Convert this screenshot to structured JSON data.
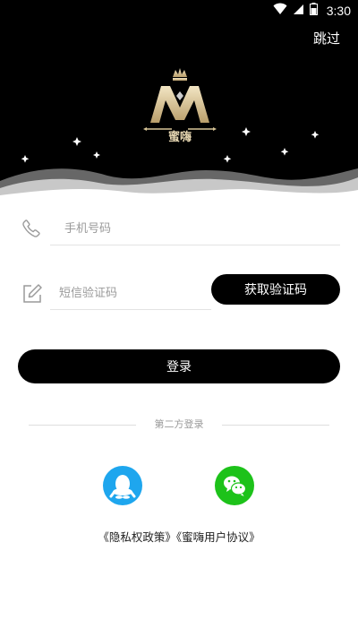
{
  "status_bar": {
    "time": "3:30",
    "icons": [
      "wifi-icon",
      "cell-signal-icon",
      "battery-icon"
    ]
  },
  "header": {
    "skip_label": "跳过",
    "logo_text": "蜜嗨",
    "logo_icon": "crown-m-logo"
  },
  "form": {
    "phone": {
      "icon": "phone-icon",
      "value": "",
      "placeholder": "手机号码"
    },
    "code": {
      "icon": "edit-icon",
      "value": "",
      "placeholder": "短信验证码"
    },
    "get_code_label": "获取验证码",
    "login_label": "登录"
  },
  "third_party": {
    "label": "第二方登录",
    "providers": [
      {
        "name": "qq-icon",
        "color": "#1ea6ee"
      },
      {
        "name": "wechat-icon",
        "color": "#1dc21a"
      }
    ]
  },
  "agreements": {
    "privacy": "《隐私权政策》",
    "user": "《蜜嗨用户协议》"
  },
  "colors": {
    "header_bg": "#000000",
    "button_bg": "#000000",
    "logo_gold": "#e7d7b2"
  }
}
